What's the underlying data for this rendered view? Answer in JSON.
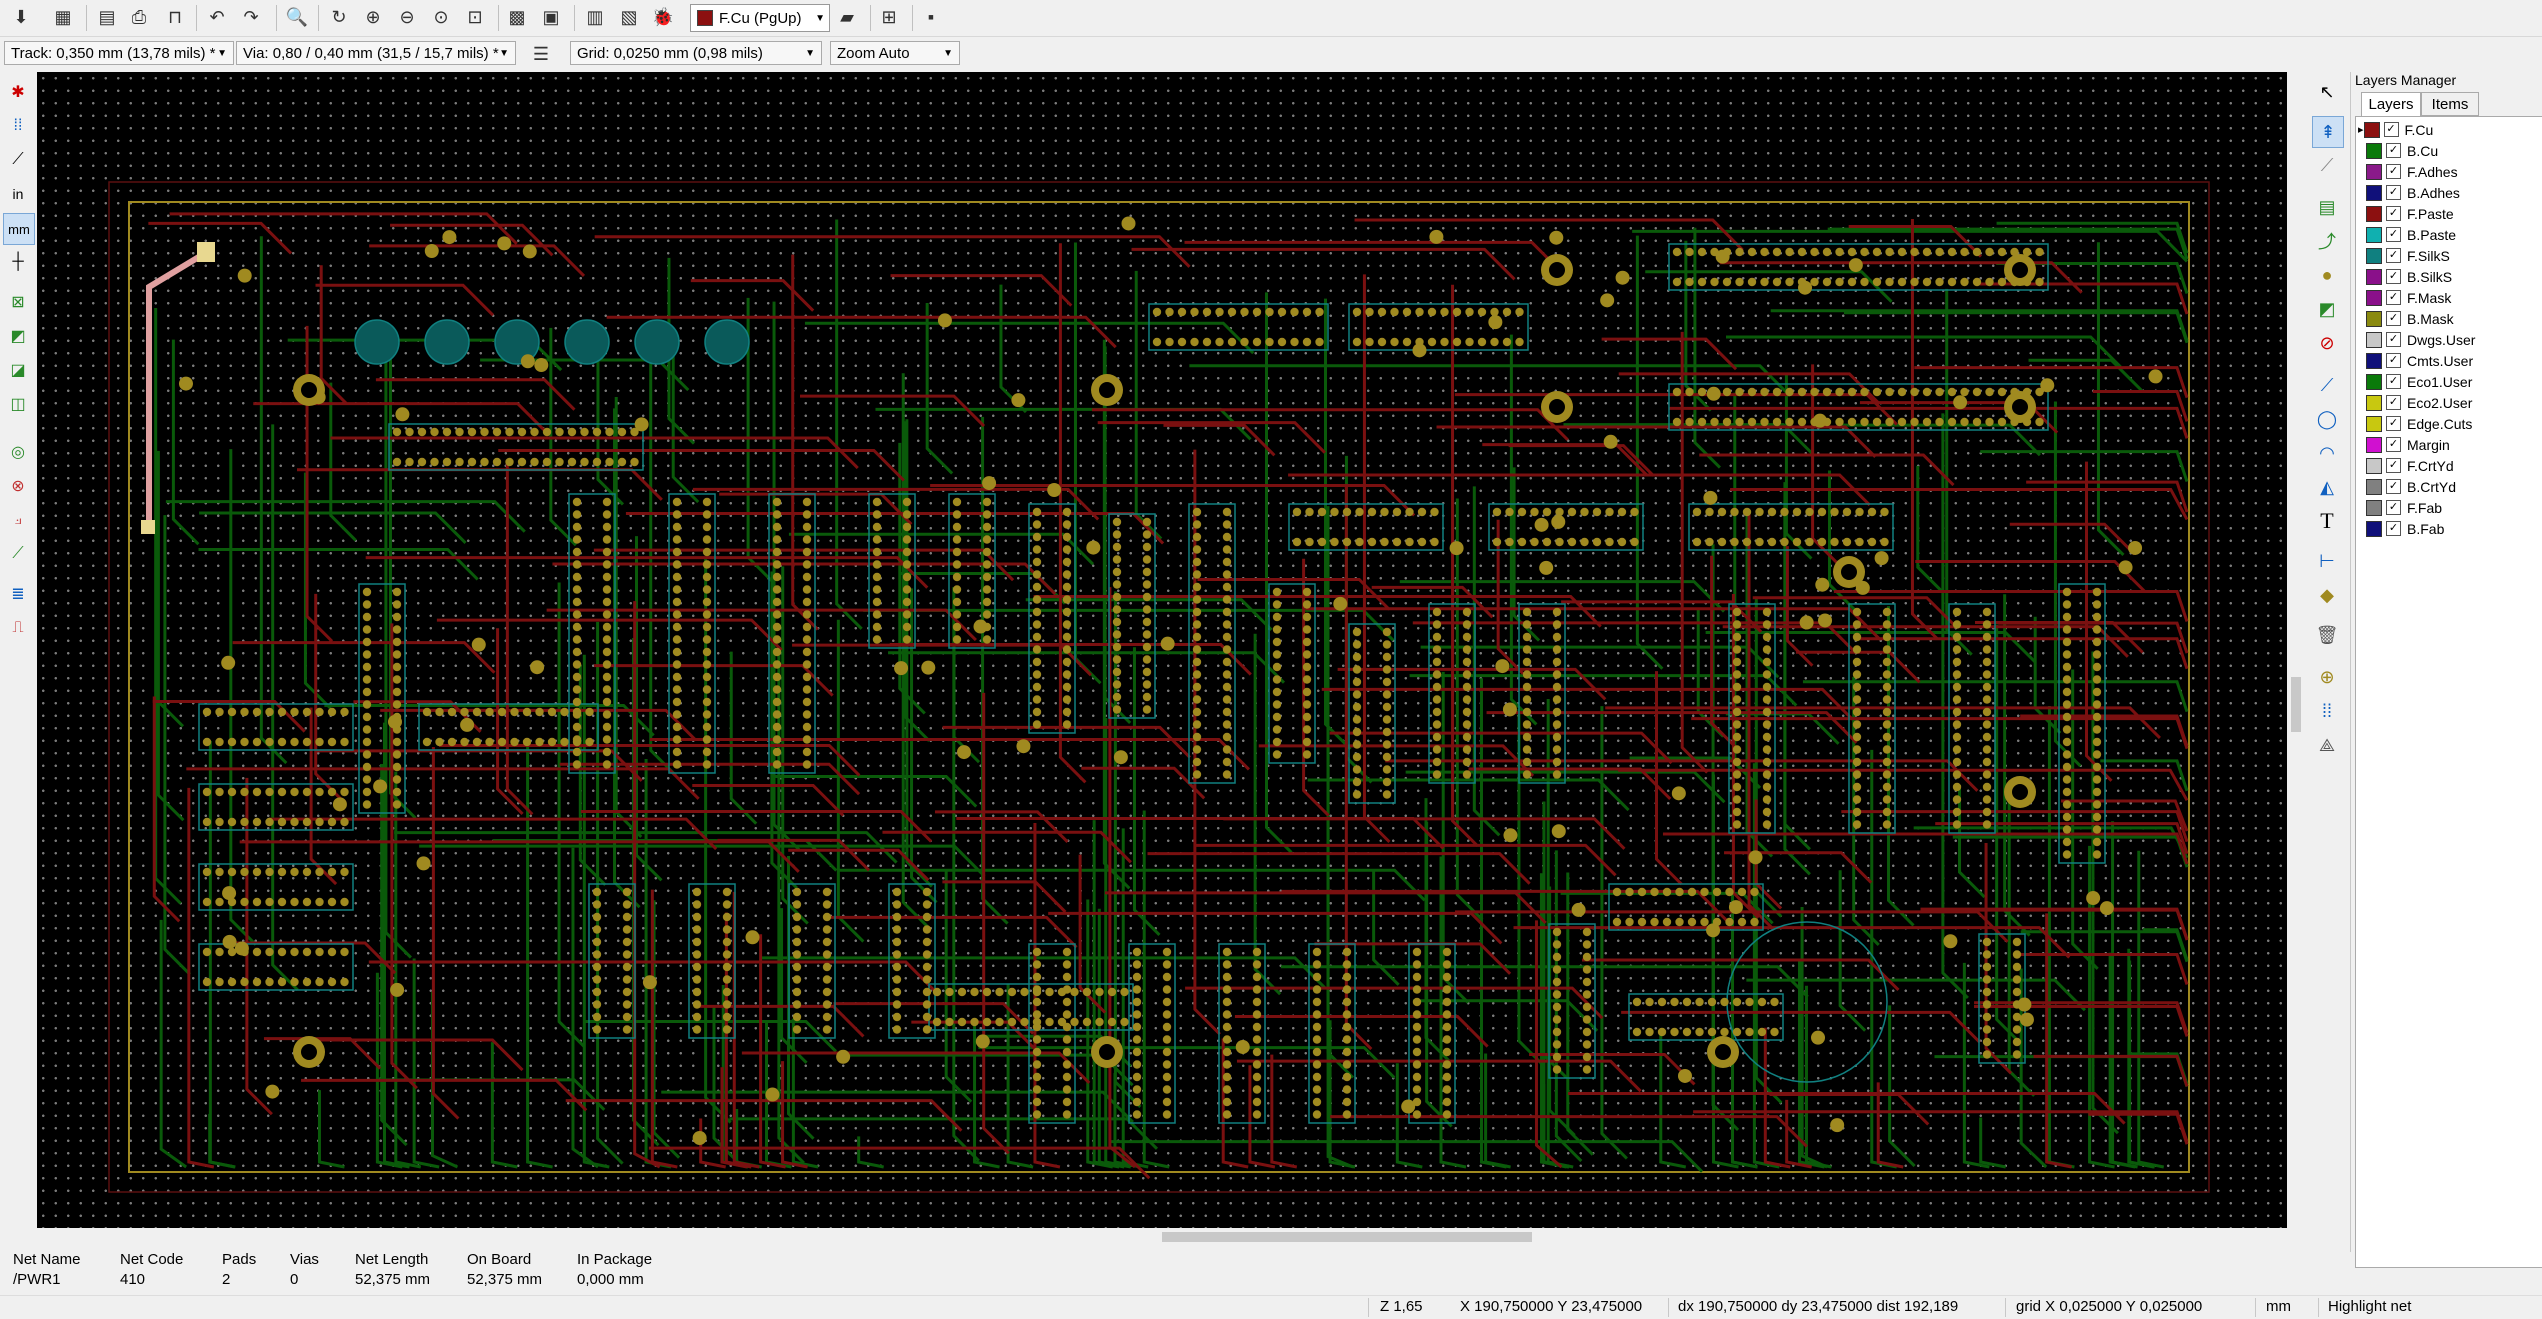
{
  "toolbar": {
    "active_layer": "F.Cu (PgUp)",
    "active_layer_color": "#8c1010",
    "icons": [
      "save-board-icon",
      "board-setup-icon",
      "page-settings-icon",
      "print-icon",
      "plot-icon",
      "undo-icon",
      "redo-icon",
      "find-icon",
      "redraw-icon",
      "zoom-in-icon",
      "zoom-out-icon",
      "zoom-fit-icon",
      "zoom-selection-icon",
      "footprint-editor-icon",
      "footprint-viewer-icon",
      "netlist-icon",
      "update-pcb-icon",
      "drc-icon",
      "layer-pair-icon",
      "scripting-icon",
      "schematic-icon",
      "python-console-icon"
    ]
  },
  "toolbar2": {
    "track": "Track: 0,350 mm (13,78 mils) *",
    "via": "Via: 0,80 / 0,40 mm (31,5 / 15,7 mils) *",
    "grid": "Grid: 0,0250 mm (0,98 mils)",
    "zoom": "Zoom Auto"
  },
  "left_toolbar": {
    "icons": [
      "drc-marker-icon",
      "grid-icon",
      "polar-coords-icon",
      "inch-units-icon",
      "mm-units-icon",
      "cursor-shape-icon",
      "ratsnest-icon",
      "zone-fill-icon",
      "zone-outline-icon",
      "zone-no-fill-icon",
      "pad-sketch-icon",
      "via-sketch-icon",
      "track-sketch-icon",
      "high-contrast-icon",
      "layer-manager-icon",
      "microwave-icon"
    ],
    "inch_label": "in",
    "mm_label": "mm"
  },
  "right_toolbar": {
    "icons": [
      "select-icon",
      "highlight-net-icon",
      "local-ratsnest-icon",
      "add-footprint-icon",
      "route-track-icon",
      "add-via-icon",
      "add-zone-icon",
      "add-keepout-icon",
      "add-line-icon",
      "add-circle-icon",
      "add-arc-icon",
      "add-polygon-icon",
      "add-text-icon",
      "add-dimension-icon",
      "add-target-icon",
      "delete-icon",
      "set-origin-icon",
      "grid-origin-icon",
      "measure-icon"
    ],
    "text_tool_label": "T"
  },
  "layers_manager": {
    "title": "Layers Manager",
    "tabs": [
      "Layers",
      "Items"
    ],
    "layers": [
      {
        "name": "F.Cu",
        "color": "#8c1010"
      },
      {
        "name": "B.Cu",
        "color": "#0a7a0a"
      },
      {
        "name": "F.Adhes",
        "color": "#8a1a8a"
      },
      {
        "name": "B.Adhes",
        "color": "#10107a"
      },
      {
        "name": "F.Paste",
        "color": "#8c1010"
      },
      {
        "name": "B.Paste",
        "color": "#10b0b0"
      },
      {
        "name": "F.SilkS",
        "color": "#108080"
      },
      {
        "name": "B.SilkS",
        "color": "#8a108a"
      },
      {
        "name": "F.Mask",
        "color": "#8a108a"
      },
      {
        "name": "B.Mask",
        "color": "#8a8a10"
      },
      {
        "name": "Dwgs.User",
        "color": "#c8c8c8"
      },
      {
        "name": "Cmts.User",
        "color": "#10107a"
      },
      {
        "name": "Eco1.User",
        "color": "#0a7a0a"
      },
      {
        "name": "Eco2.User",
        "color": "#c8c810"
      },
      {
        "name": "Edge.Cuts",
        "color": "#c8c810"
      },
      {
        "name": "Margin",
        "color": "#d010d0"
      },
      {
        "name": "F.CrtYd",
        "color": "#c8c8c8"
      },
      {
        "name": "B.CrtYd",
        "color": "#808080"
      },
      {
        "name": "F.Fab",
        "color": "#808080"
      },
      {
        "name": "B.Fab",
        "color": "#10107a"
      }
    ]
  },
  "message_panel": {
    "columns": [
      {
        "header": "Net Name",
        "value": "/PWR1"
      },
      {
        "header": "Net Code",
        "value": "410"
      },
      {
        "header": "Pads",
        "value": "2"
      },
      {
        "header": "Vias",
        "value": "0"
      },
      {
        "header": "Net Length",
        "value": "52,375 mm"
      },
      {
        "header": "On Board",
        "value": "52,375 mm"
      },
      {
        "header": "In Package",
        "value": "0,000 mm"
      }
    ]
  },
  "status_bar": {
    "zoom": "Z 1,65",
    "coords": "X 190,750000  Y 23,475000",
    "delta": "dx 190,750000  dy 23,475000  dist 192,189",
    "grid": "grid X 0,025000  Y 0,025000",
    "units": "mm",
    "tool": "Highlight net"
  },
  "colors": {
    "canvas_bg": "#000000",
    "front_copper": "#8c1010",
    "back_copper": "#0a5a0a",
    "pad": "#a08a20",
    "silk": "#108080",
    "edge": "#c8c810"
  }
}
